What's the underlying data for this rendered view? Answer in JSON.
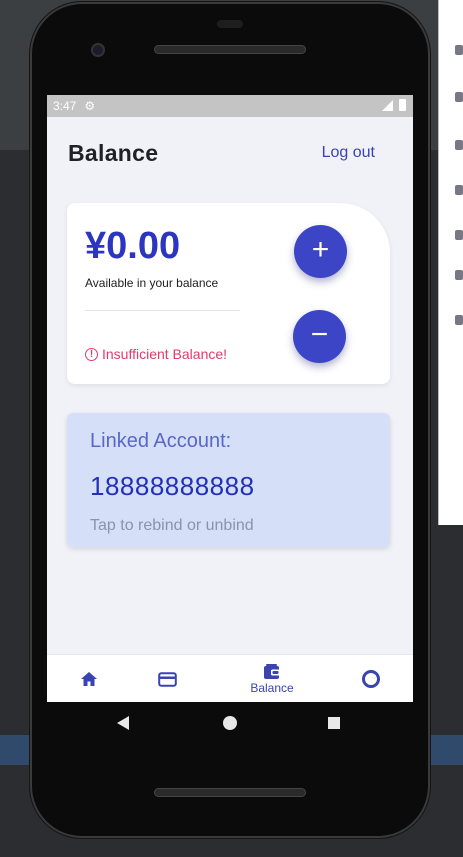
{
  "status_bar": {
    "time": "3:47"
  },
  "header": {
    "title": "Balance",
    "logout_label": "Log out"
  },
  "balance_card": {
    "amount": "¥0.00",
    "amount_label": "Available in your balance",
    "warning_text": "Insufficient Balance!",
    "add_label": "+",
    "subtract_label": "−"
  },
  "linked_account": {
    "title": "Linked Account:",
    "number": "18888888888",
    "hint": "Tap to rebind or unbind"
  },
  "bottom_nav": {
    "items": [
      {
        "icon": "home-icon",
        "label": ""
      },
      {
        "icon": "card-icon",
        "label": ""
      },
      {
        "icon": "wallet-icon",
        "label": "Balance",
        "active": true
      },
      {
        "icon": "profile-ring-icon",
        "label": ""
      }
    ]
  },
  "colors": {
    "accent": "#3c45c6",
    "warning": "#e23a6b",
    "linked_card_bg": "#d5e0f8",
    "screen_bg": "#f1f2f8"
  }
}
